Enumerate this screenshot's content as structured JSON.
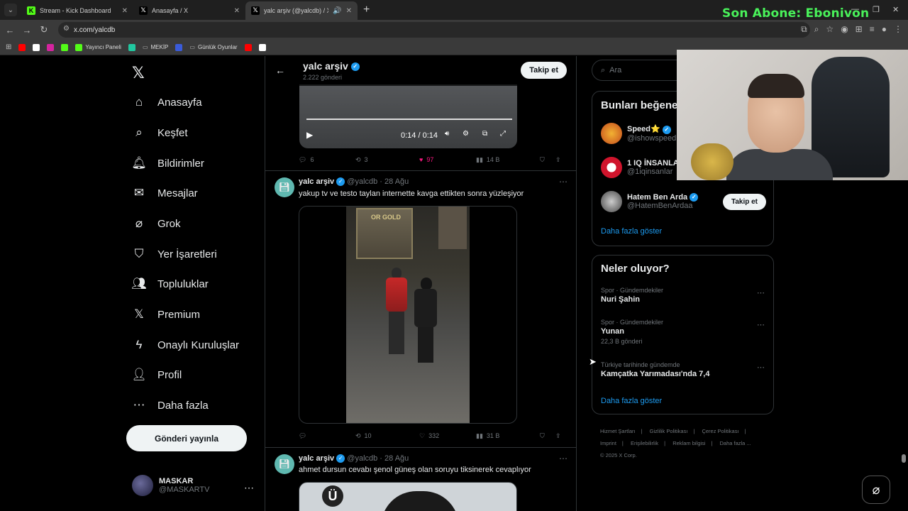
{
  "browser": {
    "tabs": [
      {
        "label": "Stream - Kick Dashboard",
        "icon": "kick-icon"
      },
      {
        "label": "Anasayfa / X",
        "icon": "x-icon"
      },
      {
        "label": "yalc arşiv (@yalcdb) / X",
        "icon": "x-icon"
      }
    ],
    "url": "x.com/yalcdb",
    "overlay": "Son Abone: Ebonivon",
    "bookmarks": [
      {
        "label": "Yayıncı Paneli",
        "color": "#53fc18"
      },
      {
        "label": "MEKİP",
        "color": "#888888"
      },
      {
        "label": "Günlük Oyunlar",
        "color": "#888888"
      }
    ]
  },
  "nav": {
    "items": [
      {
        "label": "Anasayfa",
        "icon": "home-icon"
      },
      {
        "label": "Keşfet",
        "icon": "search-icon"
      },
      {
        "label": "Bildirimler",
        "icon": "bell-icon"
      },
      {
        "label": "Mesajlar",
        "icon": "mail-icon"
      },
      {
        "label": "Grok",
        "icon": "grok-icon"
      },
      {
        "label": "Yer İşaretleri",
        "icon": "bookmark-icon"
      },
      {
        "label": "Topluluklar",
        "icon": "communities-icon"
      },
      {
        "label": "Premium",
        "icon": "x-icon"
      },
      {
        "label": "Onaylı Kuruluşlar",
        "icon": "bolt-icon"
      },
      {
        "label": "Profil",
        "icon": "person-icon"
      },
      {
        "label": "Daha fazla",
        "icon": "more-icon"
      }
    ],
    "post_button": "Gönderi yayınla",
    "account": {
      "name": "MASKAR",
      "handle": "@MASKARTV"
    }
  },
  "profile_header": {
    "name": "yalc arşiv",
    "count": "2.222 gönderi",
    "follow": "Takip et"
  },
  "tweets": [
    {
      "video_time": "0:14 / 0:14",
      "replies": "6",
      "retweets": "3",
      "likes": "97",
      "views": "14 B"
    },
    {
      "name": "yalc arşiv",
      "handle": "@yalcdb",
      "date": "28 Ağu",
      "text": "yakup tv ve testo taylan internette kavga ettikten sonra yüzleşiyor",
      "shop_sign": "OR GOLD",
      "replies": "",
      "retweets": "10",
      "likes": "332",
      "views": "31 B"
    },
    {
      "name": "yalc arşiv",
      "handle": "@yalcdb",
      "date": "28 Ağu",
      "text": "ahmet dursun cevabı şenol güneş olan soruyu tiksinerek cevaplıyor",
      "media_letter": "Ü"
    }
  ],
  "sidebar": {
    "search_placeholder": "Ara",
    "who_to_follow": {
      "title": "Bunları beğene",
      "accounts": [
        {
          "name": "Speed⭐",
          "handle": "@ishowspeed"
        },
        {
          "name": "1 IQ İNSANLA",
          "handle": "@1iqinsanlar"
        },
        {
          "name": "Hatem Ben Arda",
          "handle": "@HatemBenArdaa",
          "follow": "Takip et"
        }
      ],
      "more": "Daha fazla göster"
    },
    "trends": {
      "title": "Neler oluyor?",
      "items": [
        {
          "category": "Spor · Gündemdekiler",
          "name": "Nuri Şahin",
          "count": ""
        },
        {
          "category": "Spor · Gündemdekiler",
          "name": "Yunan",
          "count": "22,3 B gönderi"
        },
        {
          "category": "Türkiye tarihinde gündemde",
          "name": "Kamçatka Yarımadası'nda 7,4",
          "count": ""
        }
      ],
      "more": "Daha fazla göster"
    },
    "footer": [
      "Hizmet Şartları",
      "Gizlilik Politikası",
      "Çerez Politikası",
      "Imprint",
      "Erişilebilirlik",
      "Reklam bilgisi",
      "Daha fazla ...",
      "© 2025 X Corp."
    ]
  }
}
